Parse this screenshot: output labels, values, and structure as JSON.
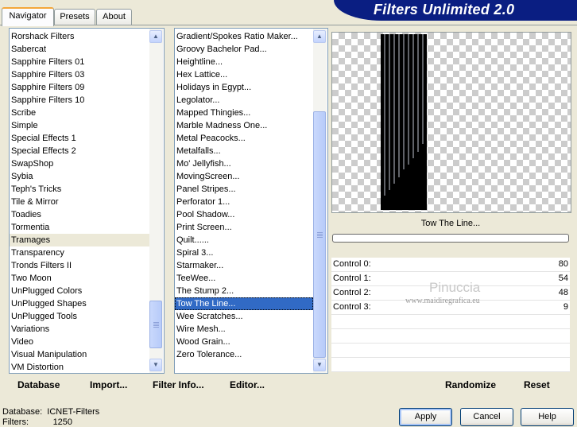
{
  "tabs": [
    {
      "label": "Navigator",
      "active": true
    },
    {
      "label": "Presets",
      "active": false
    },
    {
      "label": "About",
      "active": false
    }
  ],
  "banner_title": "Filters Unlimited 2.0",
  "categories": [
    "Rorshack Filters",
    "Sabercat",
    "Sapphire Filters 01",
    "Sapphire Filters 03",
    "Sapphire Filters 09",
    "Sapphire Filters 10",
    "Scribe",
    "Simple",
    "Special Effects 1",
    "Special Effects 2",
    "SwapShop",
    "Sybia",
    "Teph's Tricks",
    "Tile & Mirror",
    "Toadies",
    "Tormentia",
    "Tramages",
    "Transparency",
    "Tronds Filters II",
    "Two Moon",
    "UnPlugged Colors",
    "UnPlugged Shapes",
    "UnPlugged Tools",
    "Variations",
    "Video",
    "Visual Manipulation",
    "VM Distortion"
  ],
  "selected_category": "Tramages",
  "filters": [
    "Gradient/Spokes Ratio Maker...",
    "Groovy Bachelor Pad...",
    "Heightline...",
    "Hex Lattice...",
    "Holidays in Egypt...",
    "Legolator...",
    "Mapped Thingies...",
    "Marble Madness One...",
    "Metal Peacocks...",
    "Metalfalls...",
    "Mo' Jellyfish...",
    "MovingScreen...",
    "Panel Stripes...",
    "Perforator 1...",
    "Pool Shadow...",
    "Print Screen...",
    "Quilt......",
    "Spiral 3...",
    "Starmaker...",
    "TeeWee...",
    "The Stump 2...",
    "Tow The Line...",
    "Wee Scratches...",
    "Wire Mesh...",
    "Wood Grain...",
    "Zero Tolerance..."
  ],
  "selected_filter": "Tow The Line...",
  "filter_name": "Tow The Line...",
  "controls": [
    {
      "label": "Control 0:",
      "value": "80"
    },
    {
      "label": "Control 1:",
      "value": "54"
    },
    {
      "label": "Control 2:",
      "value": "48"
    },
    {
      "label": "Control 3:",
      "value": "9"
    }
  ],
  "watermark": {
    "name": "Pinuccia",
    "site": "www.maidiregrafica.eu"
  },
  "bottom_links": {
    "database": "Database",
    "import": "Import...",
    "filter_info": "Filter Info...",
    "editor": "Editor...",
    "randomize": "Randomize",
    "reset": "Reset"
  },
  "dialog_buttons": {
    "apply": "Apply",
    "cancel": "Cancel",
    "help": "Help"
  },
  "status": {
    "database_label": "Database:",
    "database_value": "ICNET-Filters",
    "filters_label": "Filters:",
    "filters_value": "1250"
  },
  "colors": {
    "banner": "#0A1E82",
    "selection": "#316AC5",
    "panel": "#ECE9D8"
  }
}
